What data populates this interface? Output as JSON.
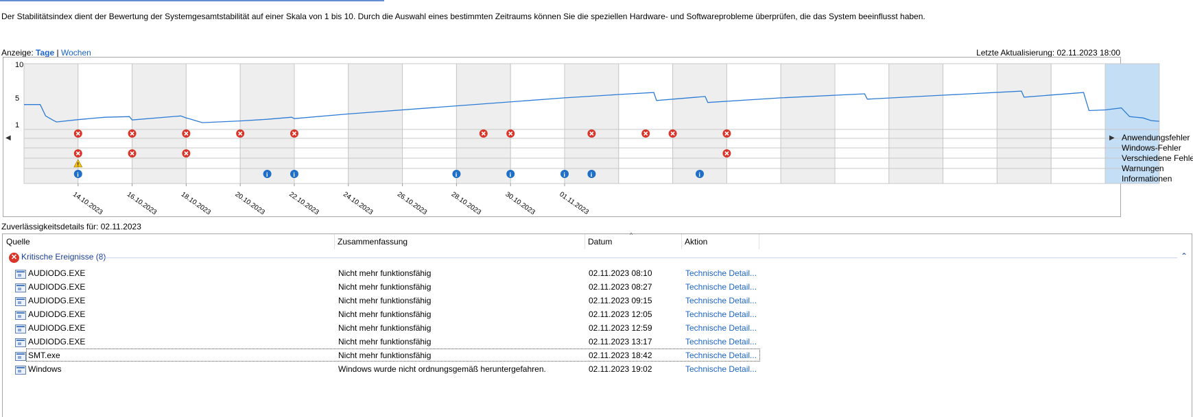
{
  "description": "Der Stabilitätsindex dient der Bewertung der Systemgesamtstabilität auf einer Skala von 1 bis 10. Durch die Auswahl eines bestimmten Zeitraums können Sie die speziellen Hardware- und Softwareprobleme überprüfen, die das System beeinflusst haben.",
  "view": {
    "label": "Anzeige:",
    "days": "Tage",
    "separator": "|",
    "weeks": "Wochen"
  },
  "last_update": "Letzte Aktualisierung: 02.11.2023 18:00",
  "chart_data": {
    "type": "line",
    "y_ticks": [
      "10",
      "5",
      "1"
    ],
    "ylim": [
      1,
      10
    ],
    "days": [
      "13.10.2023",
      "14.10.2023",
      "15.10.2023",
      "16.10.2023",
      "17.10.2023",
      "18.10.2023",
      "19.10.2023",
      "20.10.2023",
      "21.10.2023",
      "22.10.2023",
      "23.10.2023",
      "24.10.2023",
      "25.10.2023",
      "26.10.2023",
      "27.10.2023",
      "28.10.2023",
      "29.10.2023",
      "30.10.2023",
      "31.10.2023",
      "01.11.2023",
      "02.11.2023"
    ],
    "x_tick_labels": [
      "14.10.2023",
      "16.10.2023",
      "18.10.2023",
      "20.10.2023",
      "22.10.2023",
      "24.10.2023",
      "26.10.2023",
      "28.10.2023",
      "30.10.2023",
      "01.11.2023"
    ],
    "selected_day": "02.11.2023",
    "series": [
      {
        "values": [
          [
            0.0,
            4.0
          ],
          [
            0.3,
            4.0
          ],
          [
            0.4,
            2.3
          ],
          [
            0.55,
            1.6
          ],
          [
            0.6,
            1.4
          ],
          [
            1.0,
            1.75
          ],
          [
            1.5,
            2.1
          ],
          [
            1.95,
            2.2
          ],
          [
            2.0,
            1.7
          ],
          [
            2.9,
            2.3
          ],
          [
            3.0,
            2.0
          ],
          [
            3.05,
            1.9
          ],
          [
            3.3,
            1.3
          ],
          [
            4.0,
            1.55
          ],
          [
            4.5,
            1.8
          ],
          [
            4.95,
            2.1
          ],
          [
            5.0,
            1.9
          ],
          [
            6.0,
            2.6
          ],
          [
            8.0,
            3.8
          ],
          [
            10.0,
            5.0
          ],
          [
            11.0,
            5.5
          ],
          [
            11.65,
            5.8
          ],
          [
            11.7,
            4.6
          ],
          [
            12.6,
            5.2
          ],
          [
            12.65,
            4.3
          ],
          [
            14.0,
            5.0
          ],
          [
            15.55,
            5.6
          ],
          [
            15.6,
            4.8
          ],
          [
            17.0,
            5.4
          ],
          [
            18.45,
            6.0
          ],
          [
            18.5,
            5.1
          ],
          [
            19.6,
            5.8
          ],
          [
            19.7,
            3.1
          ],
          [
            20.0,
            3.2
          ],
          [
            20.3,
            3.5
          ],
          [
            20.45,
            2.2
          ],
          [
            20.7,
            2.0
          ],
          [
            20.85,
            1.6
          ],
          [
            21.0,
            1.5
          ]
        ]
      }
    ],
    "event_rows": [
      "Anwendungsfehler",
      "Windows-Fehler",
      "Verschiedene Fehler",
      "Warnungen",
      "Informationen"
    ],
    "events": [
      {
        "row": 0,
        "icon": "error-icon",
        "days": [
          1,
          3,
          5,
          7,
          9,
          16,
          17,
          20,
          22,
          23,
          25
        ]
      },
      {
        "row": 2,
        "icon": "error-icon",
        "days": [
          1,
          3,
          5,
          25
        ]
      },
      {
        "row": 3,
        "icon": "warning-icon",
        "days": [
          1
        ]
      },
      {
        "row": 4,
        "icon": "info-icon",
        "days": [
          1,
          8,
          9,
          15,
          17,
          19,
          20,
          24
        ]
      }
    ]
  },
  "details_label": "Zuverlässigkeitsdetails für: 02.11.2023",
  "columns": {
    "source": "Quelle",
    "summary": "Zusammenfassung",
    "date": "Datum",
    "action": "Aktion"
  },
  "group": {
    "title": "Kritische Ereignisse (8)"
  },
  "rows": [
    {
      "source": "AUDIODG.EXE",
      "summary": "Nicht mehr funktionsfähig",
      "date": "02.11.2023 08:10",
      "action": "Technische Detail..."
    },
    {
      "source": "AUDIODG.EXE",
      "summary": "Nicht mehr funktionsfähig",
      "date": "02.11.2023 08:27",
      "action": "Technische Detail..."
    },
    {
      "source": "AUDIODG.EXE",
      "summary": "Nicht mehr funktionsfähig",
      "date": "02.11.2023 09:15",
      "action": "Technische Detail..."
    },
    {
      "source": "AUDIODG.EXE",
      "summary": "Nicht mehr funktionsfähig",
      "date": "02.11.2023 12:05",
      "action": "Technische Detail..."
    },
    {
      "source": "AUDIODG.EXE",
      "summary": "Nicht mehr funktionsfähig",
      "date": "02.11.2023 12:59",
      "action": "Technische Detail..."
    },
    {
      "source": "AUDIODG.EXE",
      "summary": "Nicht mehr funktionsfähig",
      "date": "02.11.2023 13:17",
      "action": "Technische Detail..."
    },
    {
      "source": "SMT.exe",
      "summary": "Nicht mehr funktionsfähig",
      "date": "02.11.2023 18:42",
      "action": "Technische Detail..."
    },
    {
      "source": "Windows",
      "summary": "Windows wurde nicht ordnungsgemäß heruntergefahren.",
      "date": "02.11.2023 19:02",
      "action": "Technische Detail..."
    }
  ]
}
